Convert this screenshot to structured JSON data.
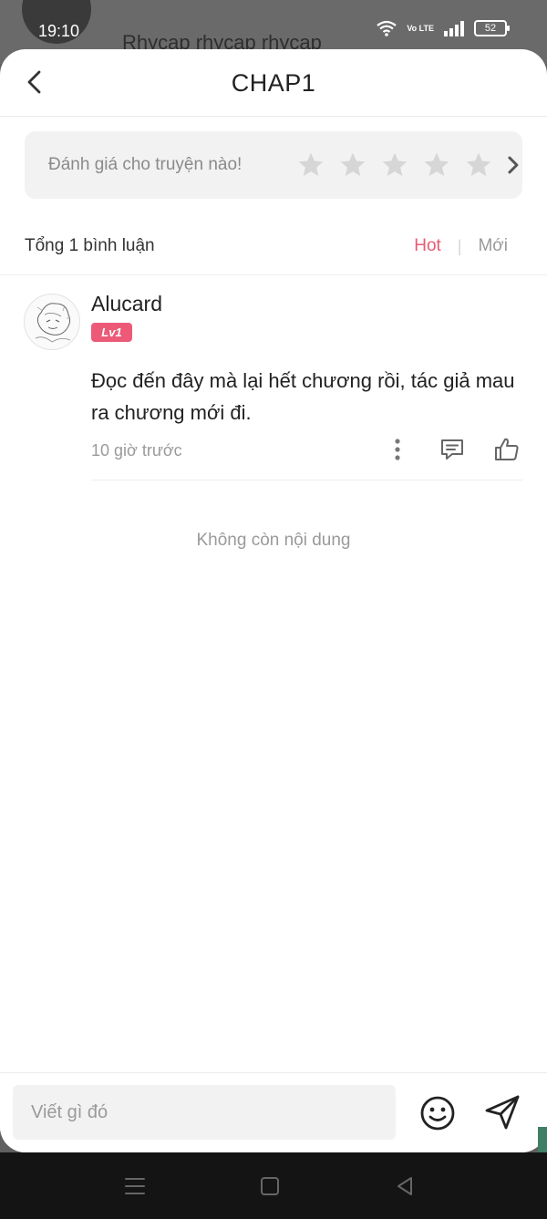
{
  "status_bar": {
    "time": "19:10",
    "network_label": "Vo LTE",
    "battery": "52"
  },
  "background_page": {
    "title": "Rhycap rhycap rhycap"
  },
  "header": {
    "title": "CHAP1"
  },
  "rating": {
    "prompt": "Đánh giá cho truyện nào!",
    "star_count": 5
  },
  "comments_bar": {
    "total": "Tổng 1 bình luận",
    "sort_hot": "Hot",
    "sort_separator": "|",
    "sort_new": "Mới"
  },
  "comments": [
    {
      "username": "Alucard",
      "level": "Lv1",
      "text": "Đọc đến đây mà lại hết chương rồi, tác giả mau ra chương mới đi.",
      "time": "10 giờ trước"
    }
  ],
  "end_message": "Không còn nội dung",
  "composer": {
    "placeholder": "Viết gì đó"
  },
  "colors": {
    "accent": "#e85a73",
    "badge": "#ec5a78",
    "star": "#d6d6d6",
    "panel": "#f2f2f2"
  }
}
